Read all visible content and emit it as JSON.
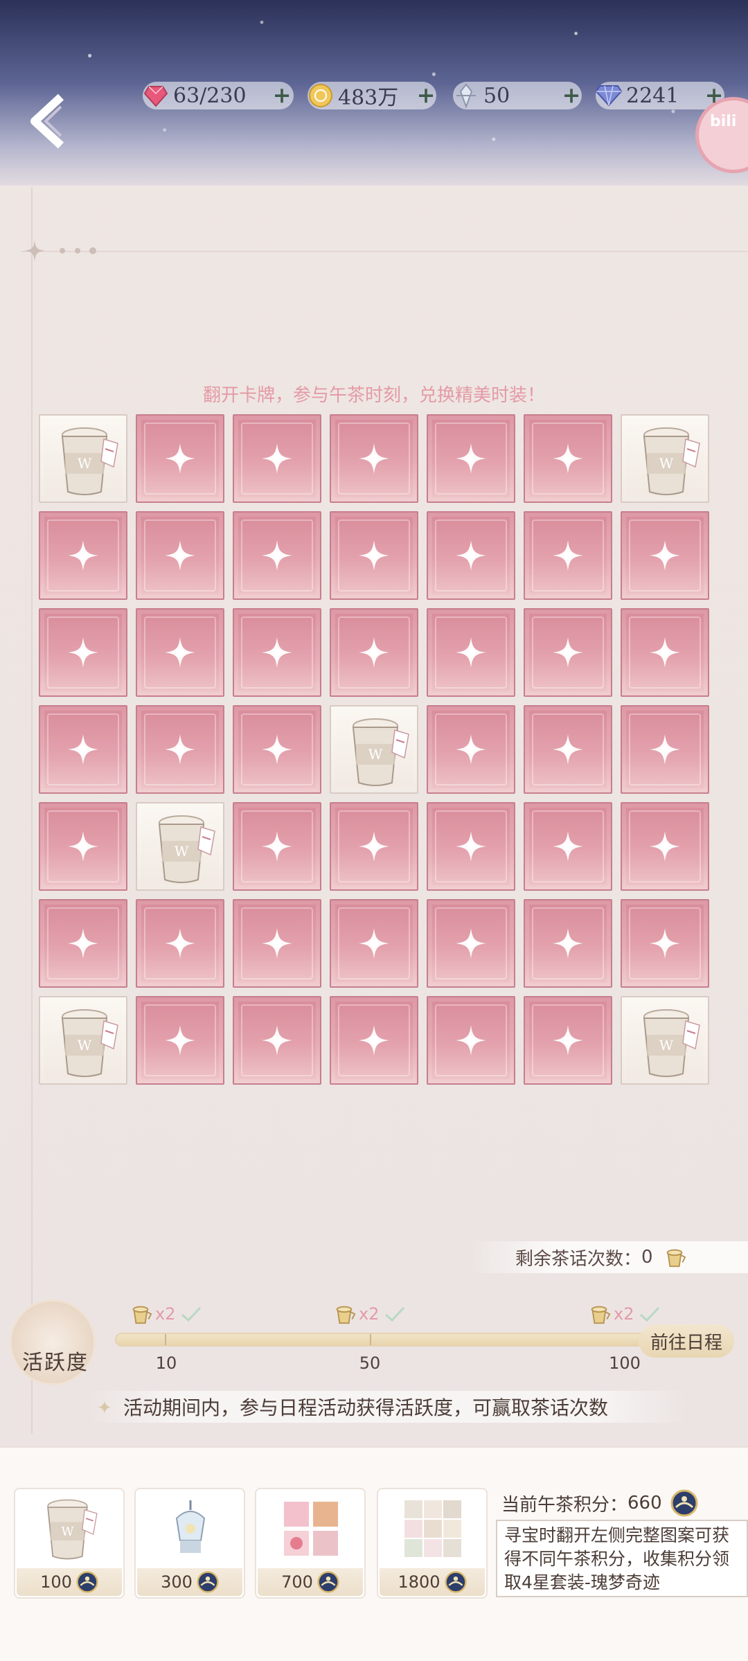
{
  "resources": [
    {
      "name": "stamina",
      "icon": "heart-gem-icon",
      "value": "63/230"
    },
    {
      "name": "gold",
      "icon": "gold-coin-icon",
      "value": "483万"
    },
    {
      "name": "crystal",
      "icon": "crystal-shard-icon",
      "value": "50"
    },
    {
      "name": "diamond",
      "icon": "diamond-icon",
      "value": "2241"
    }
  ],
  "subtitle": "翻开卡牌，参与午茶时刻，兑换精美时装！",
  "grid": {
    "rows": 7,
    "cols": 7,
    "opened": [
      [
        0,
        0
      ],
      [
        0,
        6
      ],
      [
        3,
        3
      ],
      [
        4,
        1
      ],
      [
        6,
        0
      ],
      [
        6,
        6
      ]
    ]
  },
  "remaining": {
    "label": "剩余茶话次数：",
    "value": "0"
  },
  "activity": {
    "badge_label": "活跃度",
    "progress": 0,
    "max": 100,
    "milestones": [
      {
        "value": "10",
        "reward": "x2"
      },
      {
        "value": "50",
        "reward": "x2"
      },
      {
        "value": "100",
        "reward": "x2"
      }
    ],
    "goto_label": "前往日程",
    "tip": "活动期间内，参与日程活动获得活跃度，可赢取茶话次数"
  },
  "shop": [
    {
      "price": "100",
      "icon": "coffee-cup-icon"
    },
    {
      "price": "300",
      "icon": "lamp-icon"
    },
    {
      "price": "700",
      "icon": "cosmetics-set-icon"
    },
    {
      "price": "1800",
      "icon": "outfit-set-icon"
    }
  ],
  "points": {
    "label": "当前午茶积分：",
    "value": "660"
  },
  "description": "寻宝时翻开左侧完整图案可获得不同午茶积分，收集积分领取4星套装-瑰梦奇迹",
  "colors": {
    "card_pink": "#d98b9a",
    "accent_pink": "#e49aa5",
    "gold": "#e8d5ad"
  }
}
